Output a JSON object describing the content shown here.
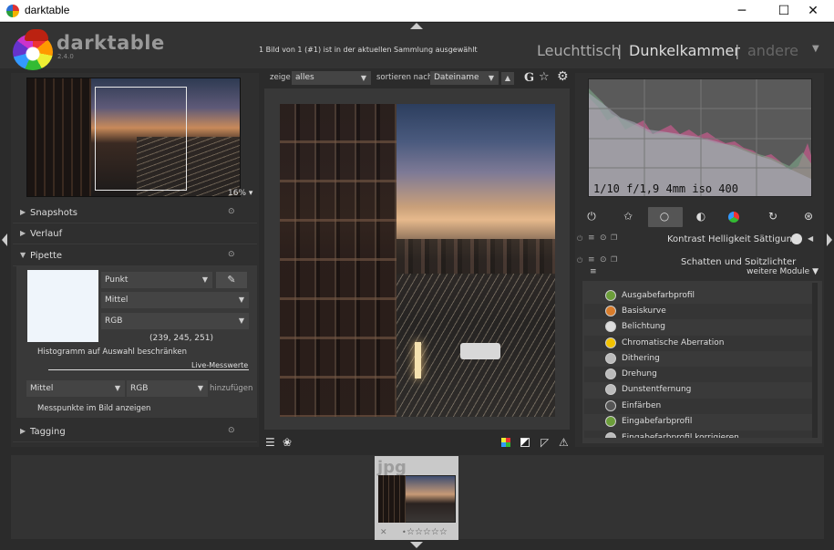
{
  "window": {
    "title": "darktable",
    "minimize": "─",
    "maximize": "☐",
    "close": "✕"
  },
  "header": {
    "logo_text": "darktable",
    "version": "2.4.0",
    "collection_info": "1 Bild von 1 (#1) ist in der aktuellen Sammlung ausgewählt",
    "views": {
      "lighttable": "Leuchttisch",
      "darkroom": "Dunkelkammer",
      "other": "andere",
      "separator": "|",
      "caret": "▼"
    }
  },
  "left_panel": {
    "zoom": "16% ▾",
    "modules": {
      "snapshots": "Snapshots",
      "history": "Verlauf",
      "pipette": "Pipette",
      "tagging": "Tagging"
    },
    "pipette": {
      "mode": "Punkt",
      "statistic": "Mittel",
      "colorspace": "RGB",
      "value": "(239, 245, 251)",
      "restrict_histogram": "Histogramm auf Auswahl beschränken",
      "live_values": "Live-Messwerte",
      "live_statistic": "Mittel",
      "live_colorspace": "RGB",
      "add": "hinzufügen",
      "show_points": "Messpunkte im Bild anzeigen",
      "swatch_color": "#eff5fb"
    }
  },
  "center": {
    "filter_label": "zeige",
    "filter_value": "alles",
    "sort_label": "sortieren nach",
    "sort_value": "Dateiname",
    "sort_dir": "▲",
    "grouping": "G",
    "star": "☆",
    "gear": "⚙"
  },
  "right_panel": {
    "exif": "1/10 f/1,9 4mm iso 400",
    "active_module": "Kontrast Helligkeit Sättigung",
    "partial_module": "Schatten und Spitzlichter",
    "more_modules": "weitere Module ▼",
    "module_list": [
      {
        "label": "Ausgabefarbprofil",
        "icon_color": "#6c9e3a"
      },
      {
        "label": "Basiskurve",
        "icon_color": "#d97c2b"
      },
      {
        "label": "Belichtung",
        "icon_color": "#dddddd"
      },
      {
        "label": "Chromatische Aberration",
        "icon_color": "#f2c200"
      },
      {
        "label": "Dithering",
        "icon_color": "#bbbbbb"
      },
      {
        "label": "Drehung",
        "icon_color": "#bbbbbb"
      },
      {
        "label": "Dunstentfernung",
        "icon_color": "#bbbbbb"
      },
      {
        "label": "Einfärben",
        "icon_color": "#555555"
      },
      {
        "label": "Eingabefarbprofil",
        "icon_color": "#6c9e3a"
      },
      {
        "label": "Eingabefarbprofil korrigieren",
        "icon_color": "#bbbbbb"
      }
    ]
  },
  "filmstrip": {
    "extension": "jpg",
    "reject": "✕",
    "stars": "☆☆☆☆☆",
    "dot": "•"
  }
}
